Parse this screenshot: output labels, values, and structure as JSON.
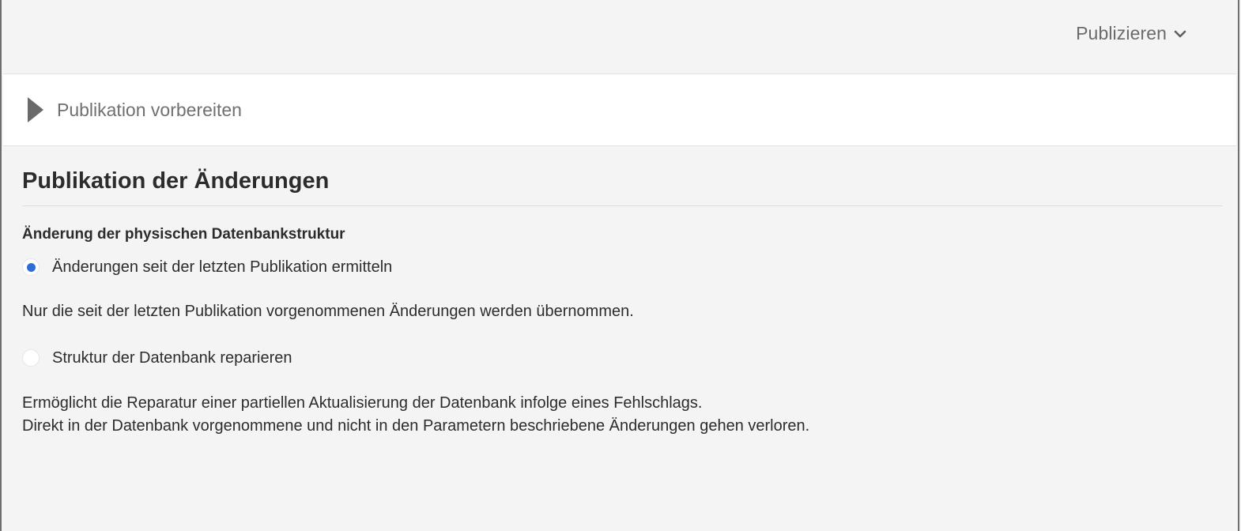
{
  "header": {
    "publish_label": "Publizieren",
    "publish_icon": "chevron-down-icon"
  },
  "prepare": {
    "label": "Publikation vorbereiten",
    "icon": "caret-right-icon",
    "expanded": false
  },
  "section": {
    "title": "Publikation der Änderungen",
    "field_label": "Änderung der physischen Datenbankstruktur",
    "options": [
      {
        "label": "Änderungen seit der letzten Publikation ermitteln",
        "selected": true,
        "description": "Nur die seit der letzten Publikation vorgenommenen Änderungen werden übernommen."
      },
      {
        "label": "Struktur der Datenbank reparieren",
        "selected": false,
        "description_lines": [
          "Ermöglicht die Reparatur einer partiellen Aktualisierung der Datenbank infolge eines Fehlschlags.",
          "Direkt in der Datenbank vorgenommene und nicht in den Parametern beschriebene Änderungen gehen verloren."
        ]
      }
    ]
  },
  "colors": {
    "accent": "#2d6ed6",
    "background": "#f4f4f4",
    "panel": "#ffffff",
    "muted_text": "#707070"
  }
}
